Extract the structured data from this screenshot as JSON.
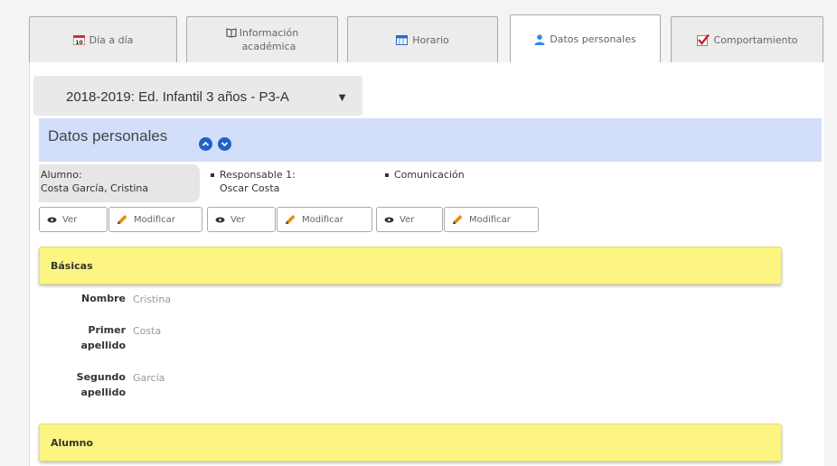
{
  "tabs": [
    {
      "label": "Día a día",
      "icon": "calendar-icon",
      "active": false
    },
    {
      "label": "Información\nacadémica",
      "icon": "book-icon",
      "active": false
    },
    {
      "label": "Horario",
      "icon": "schedule-icon",
      "active": false
    },
    {
      "label": "Datos personales",
      "icon": "person-icon",
      "active": true
    },
    {
      "label": "Comportamiento",
      "icon": "checkmark-icon",
      "active": false
    }
  ],
  "calendar_icon_text": "10",
  "year_selector": {
    "value": "2018-2019: Ed. Infantil 3 años - P3-A"
  },
  "section": {
    "title": "Datos personales"
  },
  "roles": {
    "alumno_label": "Alumno:",
    "alumno_name": "Costa García, Cristina",
    "responsable_label": "Responsable 1:",
    "responsable_name": "Oscar Costa",
    "comunicacion_label": "Comunicación"
  },
  "buttons": {
    "ver": "Ver",
    "modificar": "Modificar"
  },
  "panels": {
    "basicas": "Básicas",
    "alumno": "Alumno"
  },
  "fields": [
    {
      "label": "Nombre",
      "value": "Cristina"
    },
    {
      "label": "Primer\napellido",
      "value": "Costa"
    },
    {
      "label": "Segundo\napellido",
      "value": "García"
    }
  ],
  "colors": {
    "accent_blue": "#1f63c9",
    "section_header_bg": "#d3defa",
    "panel_yellow": "#fdf582",
    "checkmark_red": "#cc1f2e"
  }
}
